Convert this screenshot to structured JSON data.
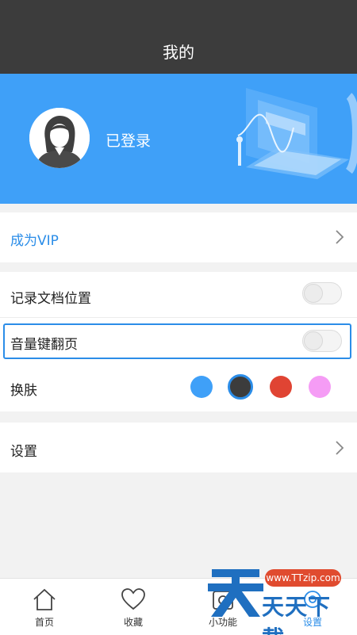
{
  "header": {
    "title": "我的"
  },
  "profile": {
    "status": "已登录"
  },
  "vip": {
    "label": "成为VIP"
  },
  "toggles": [
    {
      "label": "记录文档位置",
      "on": false
    },
    {
      "label": "音量键翻页",
      "on": false
    }
  ],
  "skin": {
    "label": "换肤",
    "colors": [
      "#3fa0f8",
      "#3c3c3c",
      "#e04433",
      "#f59cf5"
    ],
    "selected_index": 1
  },
  "settings": {
    "label": "设置"
  },
  "tabbar": {
    "items": [
      {
        "label": "首页",
        "icon": "home-icon"
      },
      {
        "label": "收藏",
        "icon": "heart-icon"
      },
      {
        "label": "小功能",
        "icon": "tools-icon"
      },
      {
        "label": "设置",
        "icon": "settings-icon"
      }
    ],
    "active_index": 3
  },
  "watermark": {
    "url": "www.TTzip.com",
    "text": "天天下載"
  }
}
